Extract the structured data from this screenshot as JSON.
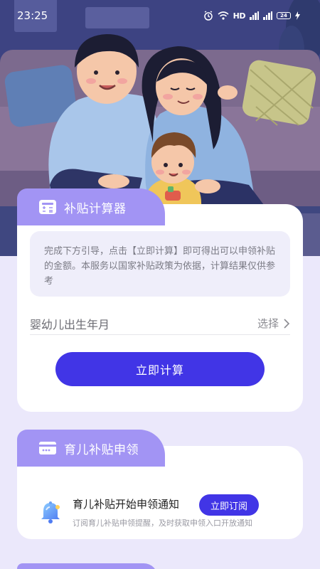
{
  "status_bar": {
    "time": "23:25",
    "network_label": "HD",
    "battery_level": "24"
  },
  "hero": {
    "icon": "family-illustration"
  },
  "calculator": {
    "tab_title": "补贴计算器",
    "tab_icon": "calculator-icon",
    "intro_text": "完成下方引导，点击【立即计算】即可得出可以申领补贴的金额。本服务以国家补贴政策为依据，计算结果仅供参考",
    "birth_label": "婴幼儿出生年月",
    "birth_select": "选择",
    "calc_button": "立即计算"
  },
  "subsidy": {
    "tab_title": "育儿补贴申领",
    "tab_icon": "card-icon",
    "notify_title": "育儿补贴开始申领通知",
    "notify_desc": "订阅育儿补贴申领提醒，及时获取申领入口开放通知",
    "subscribe_button": "立即订阅",
    "notify_icon": "bell-icon"
  },
  "colors": {
    "page_bg": "#ebe8fb",
    "tab_bg": "#a294f4",
    "primary": "#4135e6",
    "intro_bg": "#efeefa"
  }
}
